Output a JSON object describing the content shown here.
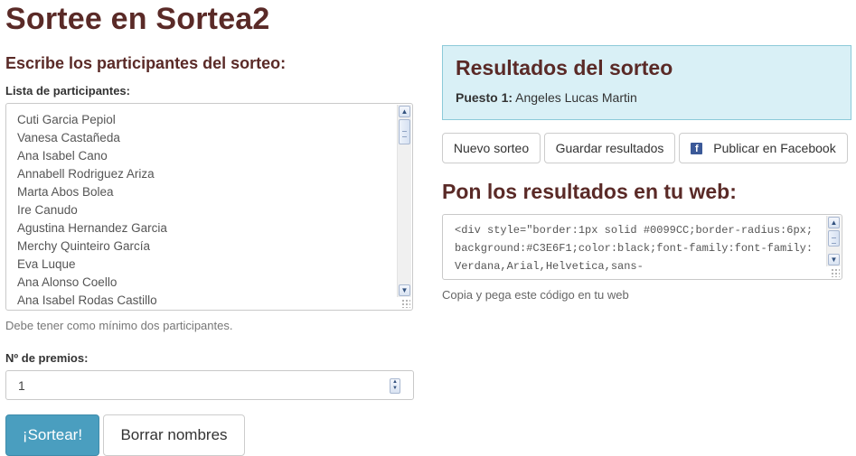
{
  "page": {
    "title": "Sortee en Sortea2"
  },
  "form": {
    "heading": "Escribe los participantes del sorteo:",
    "participants_label": "Lista de participantes:",
    "participants": [
      "Cuti Garcia Pepiol",
      "Vanesa Castañeda",
      "Ana Isabel Cano",
      "Annabell Rodriguez Ariza",
      "Marta Abos Bolea",
      "Ire Canudo",
      "Agustina Hernandez Garcia",
      "Merchy Quinteiro García",
      "Eva Luque",
      "Ana Alonso Coello",
      "Ana Isabel Rodas Castillo"
    ],
    "min_hint": "Debe tener como mínimo dos participantes.",
    "prizes_label": "Nº de premios:",
    "prizes_value": "1",
    "draw_button": "¡Sortear!",
    "clear_button": "Borrar nombres"
  },
  "results": {
    "title": "Resultados del sorteo",
    "position_label": "Puesto 1:",
    "winner": "Angeles Lucas Martin",
    "new_button": "Nuevo sorteo",
    "save_button": "Guardar resultados",
    "facebook_button": "Publicar en Facebook",
    "facebook_icon": "facebook-icon"
  },
  "embed": {
    "heading": "Pon los resultados en tu web:",
    "code": "<div style=\"border:1px solid #0099CC;border-radius:6px;background:#C3E6F1;color:black;font-family:font-family: Verdana,Arial,Helvetica,sans-",
    "hint": "Copia y pega este código en tu web"
  },
  "colors": {
    "heading": "#5a2a27",
    "primary_button": "#4a9ebf",
    "results_bg": "#d9f0f6",
    "results_border": "#8ccad9",
    "facebook": "#3b5998"
  }
}
